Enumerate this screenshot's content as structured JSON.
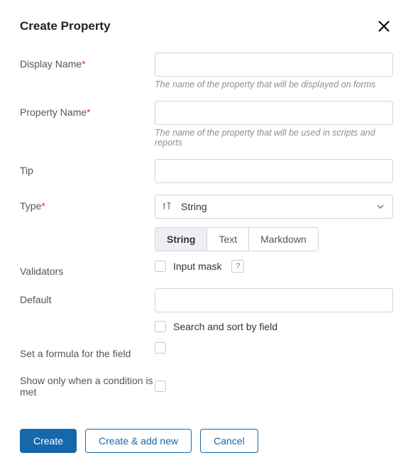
{
  "header": {
    "title": "Create Property"
  },
  "fields": {
    "displayName": {
      "label": "Display Name",
      "required": true,
      "value": "",
      "helper": "The name of the property that will be displayed on forms"
    },
    "propertyName": {
      "label": "Property Name",
      "required": true,
      "value": "",
      "helper": "The name of the property that will be used in scripts and reports"
    },
    "tip": {
      "label": "Tip",
      "value": ""
    },
    "type": {
      "label": "Type",
      "required": true,
      "selected": "String",
      "options": [
        "String",
        "Text",
        "Markdown"
      ]
    },
    "validators": {
      "label": "Validators",
      "inputMaskLabel": "Input mask",
      "helpGlyph": "?"
    },
    "default": {
      "label": "Default",
      "value": "",
      "searchSortLabel": "Search and sort by field"
    },
    "formula": {
      "label": "Set a formula for the field"
    },
    "condition": {
      "label": "Show only when a condition is met"
    }
  },
  "footer": {
    "create": "Create",
    "createAdd": "Create & add new",
    "cancel": "Cancel"
  }
}
